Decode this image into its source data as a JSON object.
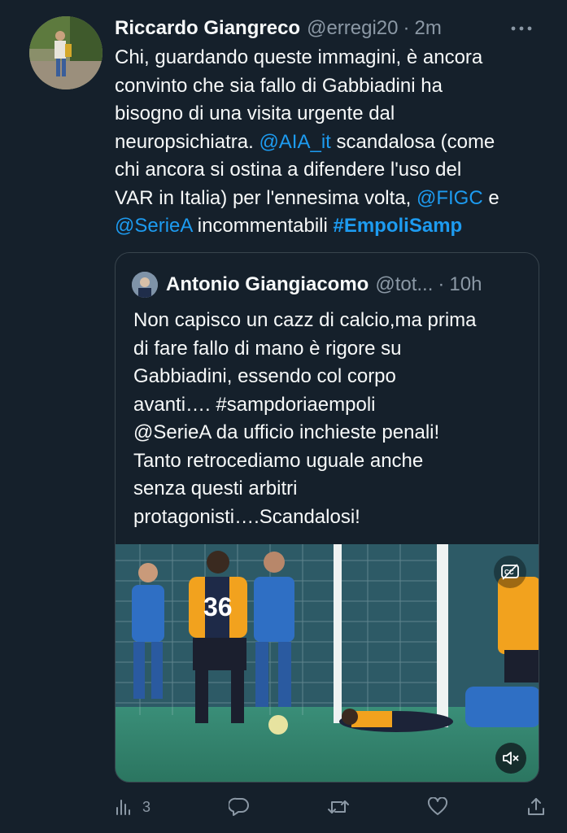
{
  "tweet": {
    "author_name": "Riccardo Giangreco",
    "handle": "@erregi20",
    "separator": "·",
    "time": "2m",
    "more_icon": "more-horizontal-icon",
    "body_lines": [
      [
        {
          "t": "Chi, guardando queste immagini, è ancora",
          "k": "text"
        }
      ],
      [
        {
          "t": "convinto che sia fallo di Gabbiadini ha",
          "k": "text"
        }
      ],
      [
        {
          "t": "bisogno di una visita urgente dal",
          "k": "text"
        }
      ],
      [
        {
          "t": "neuropsichiatra. ",
          "k": "text"
        },
        {
          "t": "@AIA_it",
          "k": "link"
        },
        {
          "t": " scandalosa (come",
          "k": "text"
        }
      ],
      [
        {
          "t": "chi ancora si ostina a difendere l'uso del",
          "k": "text"
        }
      ],
      [
        {
          "t": "VAR in Italia) per l'ennesima volta, ",
          "k": "text"
        },
        {
          "t": "@FIGC",
          "k": "link"
        },
        {
          "t": " e",
          "k": "text"
        }
      ],
      [
        {
          "t": "@SerieA",
          "k": "link"
        },
        {
          "t": " incommentabili ",
          "k": "text"
        },
        {
          "t": "#EmpoliSamp",
          "k": "hashtag"
        }
      ]
    ]
  },
  "quoted_tweet": {
    "author_name": "Antonio Giangiacomo",
    "handle": "@tot...",
    "separator": "·",
    "time": "10h",
    "body_lines": [
      "Non capisco un cazz di calcio,ma prima",
      "di fare fallo di mano è rigore su",
      "Gabbiadini, essendo col corpo",
      "avanti…. #sampdoriaempoli",
      "@SerieA da ufficio inchieste penali!",
      "Tanto retrocediamo uguale anche",
      "senza questi arbitri",
      "protagonisti….Scandalosi!"
    ],
    "media": {
      "player_number": "36",
      "captions_icon": "closed-captions-icon",
      "mute_icon": "volume-muted-icon"
    }
  },
  "actions": {
    "views_icon": "analytics-icon",
    "views_count": "3",
    "reply_icon": "reply-icon",
    "retweet_icon": "retweet-icon",
    "like_icon": "heart-icon",
    "share_icon": "share-icon"
  },
  "colors": {
    "background": "#15202b",
    "link": "#1d9bf0",
    "secondary_text": "#8b98a5",
    "border": "#38444d"
  }
}
